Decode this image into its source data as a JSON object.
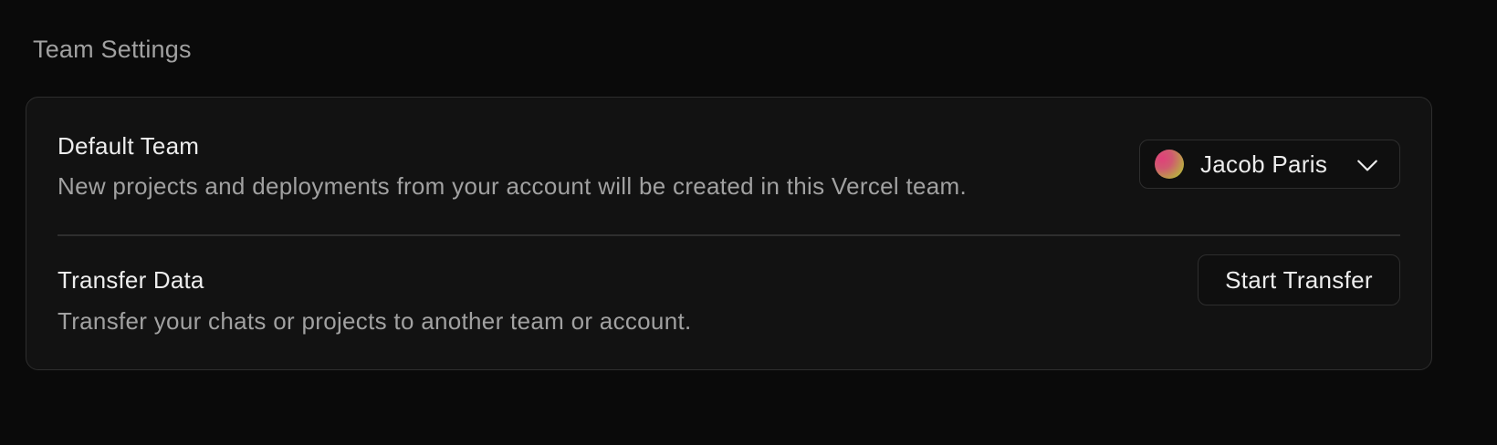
{
  "section": {
    "title": "Team Settings"
  },
  "default_team": {
    "title": "Default Team",
    "description": "New projects and deployments from your account will be created in this Vercel team.",
    "selected_team": "Jacob Paris",
    "avatar_icon": "gradient-avatar",
    "dropdown_icon": "chevron-down-icon"
  },
  "transfer_data": {
    "title": "Transfer Data",
    "description": "Transfer your chats or projects to another team or account.",
    "button_label": "Start Transfer"
  },
  "colors": {
    "background": "#0a0a0a",
    "card_background": "#121212",
    "border": "#2e2e2e",
    "primary_text": "#ededed",
    "secondary_text": "#a1a1a1"
  }
}
